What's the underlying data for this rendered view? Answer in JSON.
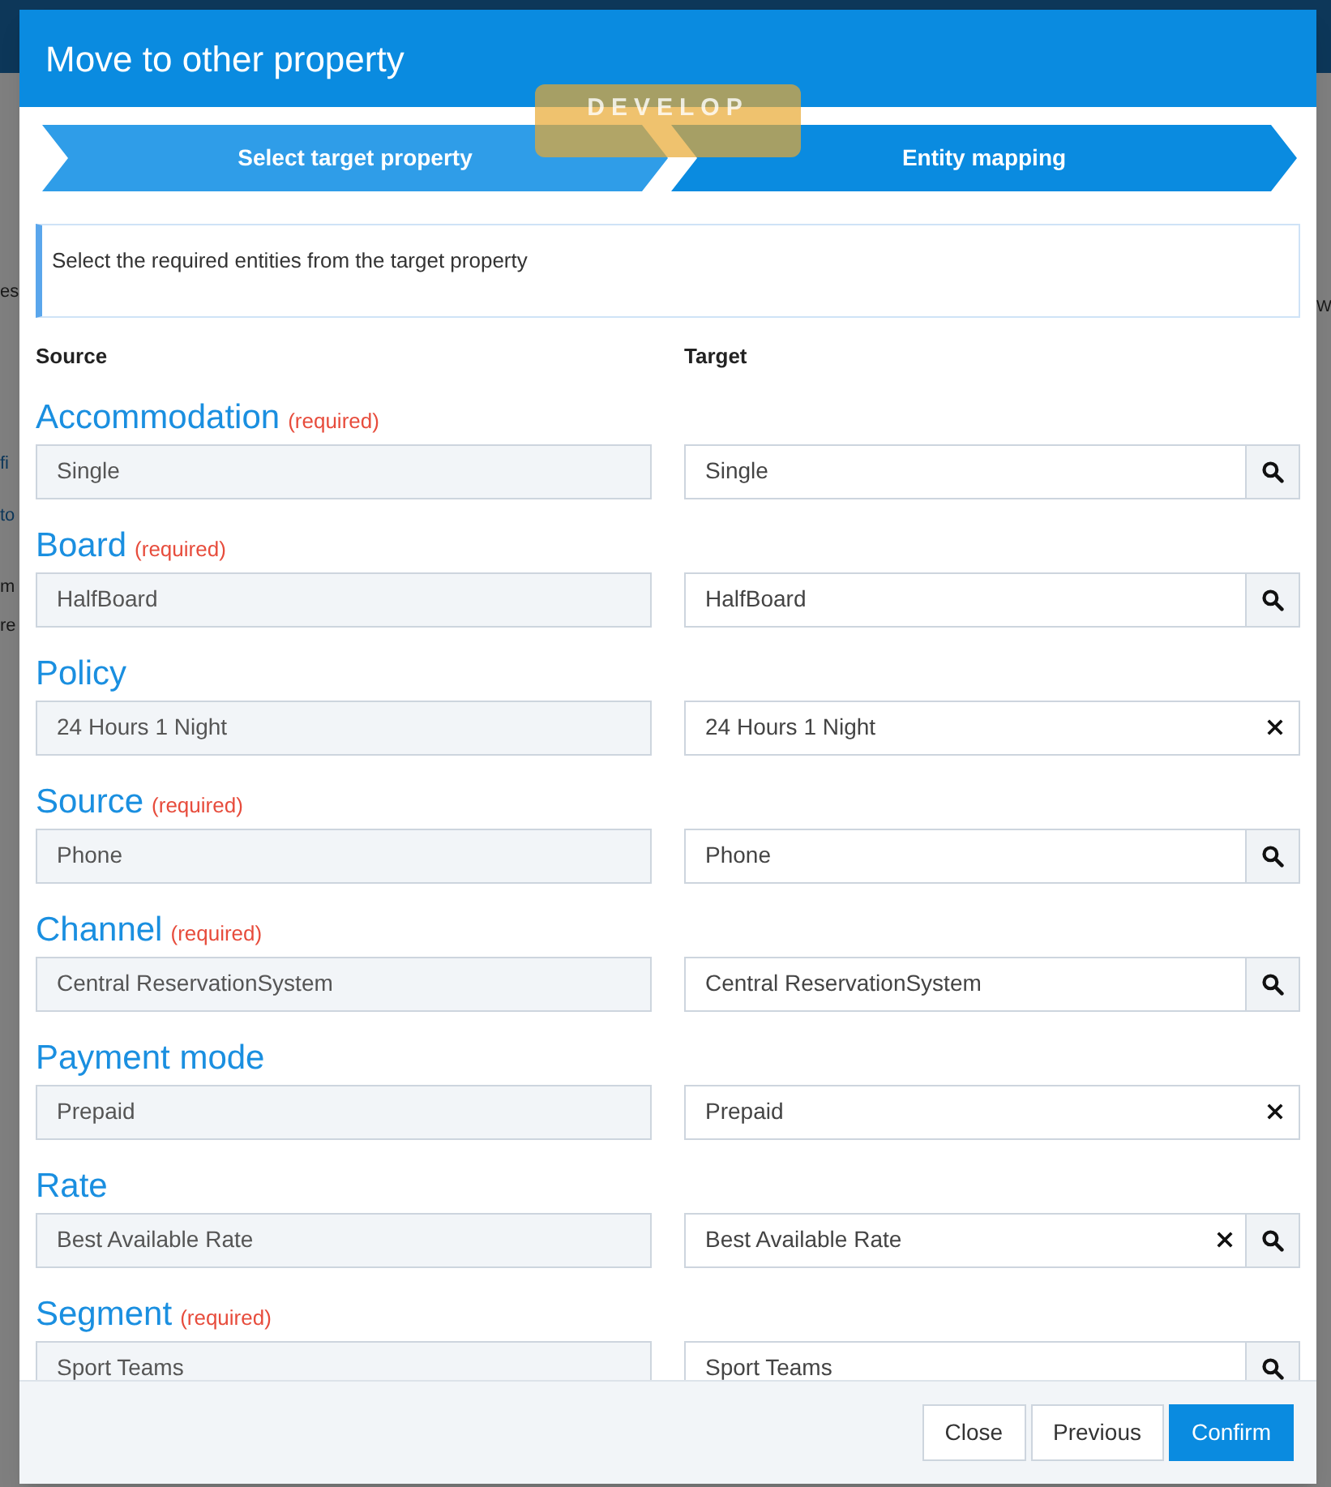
{
  "background_fragments": {
    "left": [
      {
        "text": "es",
        "kind": "text"
      },
      {
        "text": "fi",
        "kind": "link"
      },
      {
        "text": "to",
        "kind": "link"
      },
      {
        "text": "m",
        "kind": "text"
      },
      {
        "text": "re",
        "kind": "text"
      }
    ],
    "right": [
      "W"
    ]
  },
  "dialog": {
    "title": "Move to other property",
    "environment_badge": "DEVELOP",
    "steps": [
      {
        "label": "Select target property",
        "selected": false
      },
      {
        "label": "Entity mapping",
        "selected": true
      }
    ],
    "info": "Select the required entities from the target property",
    "columns": [
      "Source",
      "Target"
    ],
    "mappings": [
      {
        "label": "Accommodation",
        "required_note": "(required)",
        "source_value": "Single",
        "target_value": "Single",
        "clearable": false,
        "searchable": true
      },
      {
        "label": "Board",
        "required_note": "(required)",
        "source_value": "HalfBoard",
        "target_value": "HalfBoard",
        "clearable": false,
        "searchable": true
      },
      {
        "label": "Policy",
        "source_value": "24 Hours 1 Night",
        "target_value": "24 Hours 1 Night",
        "clearable": true,
        "searchable": false
      },
      {
        "label": "Source",
        "required_note": "(required)",
        "source_value": "Phone",
        "target_value": "Phone",
        "clearable": false,
        "searchable": true
      },
      {
        "label": "Channel",
        "required_note": "(required)",
        "source_value": "Central ReservationSystem",
        "target_value": "Central ReservationSystem",
        "clearable": false,
        "searchable": true
      },
      {
        "label": "Payment mode",
        "source_value": "Prepaid",
        "target_value": "Prepaid",
        "clearable": true,
        "searchable": false
      },
      {
        "label": "Rate",
        "source_value": "Best Available Rate",
        "target_value": "Best Available Rate",
        "clearable": true,
        "searchable": true
      },
      {
        "label": "Segment",
        "required_note": "(required)",
        "source_value": "Sport Teams",
        "target_value": "Sport Teams",
        "clearable": false,
        "searchable": true
      }
    ],
    "buttons": [
      {
        "label": "Close",
        "kind": "default"
      },
      {
        "label": "Previous",
        "kind": "default"
      },
      {
        "label": "Confirm",
        "kind": "primary"
      }
    ]
  }
}
